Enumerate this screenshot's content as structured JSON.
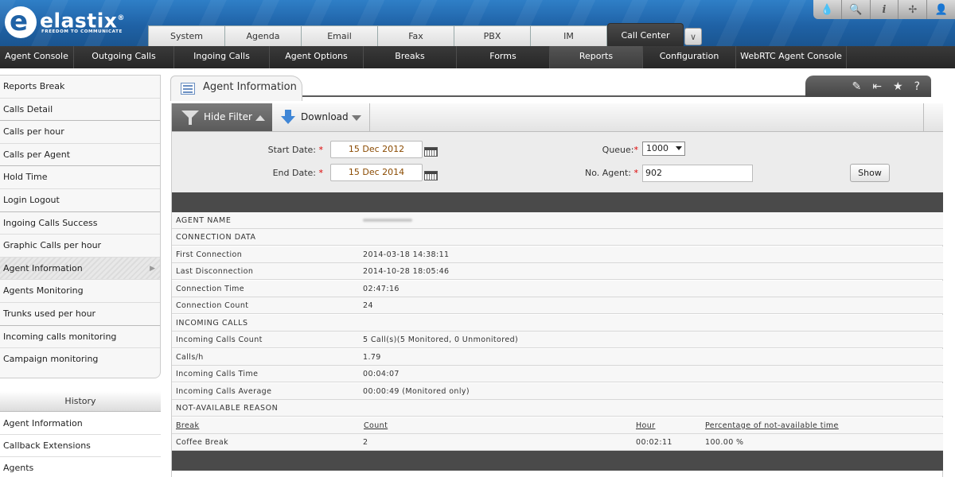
{
  "header": {
    "logo_text": "elastix",
    "logo_tagline": "FREEDOM TO COMMUNICATE",
    "logo_reg": "®",
    "top_icons": [
      "drop-icon",
      "search-icon",
      "info-icon",
      "puzzle-icon",
      "user-icon"
    ],
    "tabs": [
      {
        "label": "System"
      },
      {
        "label": "Agenda"
      },
      {
        "label": "Email"
      },
      {
        "label": "Fax"
      },
      {
        "label": "PBX"
      },
      {
        "label": "IM"
      },
      {
        "label": "Call Center",
        "active": true
      }
    ]
  },
  "navbar": {
    "items": [
      {
        "label": "Agent Console"
      },
      {
        "label": "Outgoing Calls"
      },
      {
        "label": "Ingoing Calls"
      },
      {
        "label": "Agent Options"
      },
      {
        "label": "Breaks"
      },
      {
        "label": "Forms"
      },
      {
        "label": "Reports",
        "active": true
      },
      {
        "label": "Configuration"
      },
      {
        "label": "WebRTC Agent Console"
      }
    ]
  },
  "sidebar": {
    "items": [
      {
        "label": "Reports Break"
      },
      {
        "label": "Calls Detail"
      },
      {
        "label": "Calls per hour"
      },
      {
        "label": "Calls per Agent"
      },
      {
        "label": "Hold Time"
      },
      {
        "label": "Login Logout"
      },
      {
        "label": "Ingoing Calls Success"
      },
      {
        "label": "Graphic Calls per hour"
      },
      {
        "label": "Agent Information",
        "active": true
      },
      {
        "label": "Agents Monitoring"
      },
      {
        "label": "Trunks used per hour"
      },
      {
        "label": "Incoming calls monitoring"
      },
      {
        "label": "Campaign monitoring"
      }
    ],
    "history_title": "History",
    "history": [
      {
        "label": "Agent Information"
      },
      {
        "label": "Callback Extensions"
      },
      {
        "label": "Agents"
      }
    ]
  },
  "panel": {
    "title": "Agent Information",
    "actions": [
      "edit-icon",
      "collapse-icon",
      "star-icon",
      "help-icon"
    ],
    "action_help": "?"
  },
  "toolbar": {
    "hide_filter": "Hide Filter",
    "download": "Download"
  },
  "filter": {
    "start_date_label": "Start Date:",
    "start_date": "15 Dec 2012",
    "end_date_label": "End Date:",
    "end_date": "15 Dec 2014",
    "queue_label": "Queue:",
    "queue_value": "1000",
    "agent_label": "No. Agent:",
    "agent_value": "902",
    "required_mark": "*",
    "show_button": "Show"
  },
  "report": {
    "agent_name_label": "AGENT NAME",
    "connection_section": "CONNECTION DATA",
    "connection_rows": [
      {
        "label": "First Connection",
        "value": "2014-03-18 14:38:11"
      },
      {
        "label": "Last Disconnection",
        "value": "2014-10-28 18:05:46"
      },
      {
        "label": "Connection Time",
        "value": "02:47:16"
      },
      {
        "label": "Connection Count",
        "value": "24"
      }
    ],
    "incoming_section": "INCOMING CALLS",
    "incoming_rows": [
      {
        "label": "Incoming Calls Count",
        "value": "5 Call(s)(5 Monitored, 0 Unmonitored)"
      },
      {
        "label": "Calls/h",
        "value": "1.79"
      },
      {
        "label": "Incoming Calls Time",
        "value": "00:04:07"
      },
      {
        "label": "Incoming Calls Average",
        "value": "00:00:49 (Monitored only)"
      }
    ],
    "not_available_section": "NOT-AVAILABLE REASON",
    "break_headers": {
      "break": "Break",
      "count": "Count",
      "hour": "Hour",
      "percentage": "Percentage of not-available time"
    },
    "break_rows": [
      {
        "break": "Coffee Break",
        "count": "2",
        "hour": "00:02:11",
        "percentage": "100.00 %"
      }
    ]
  }
}
